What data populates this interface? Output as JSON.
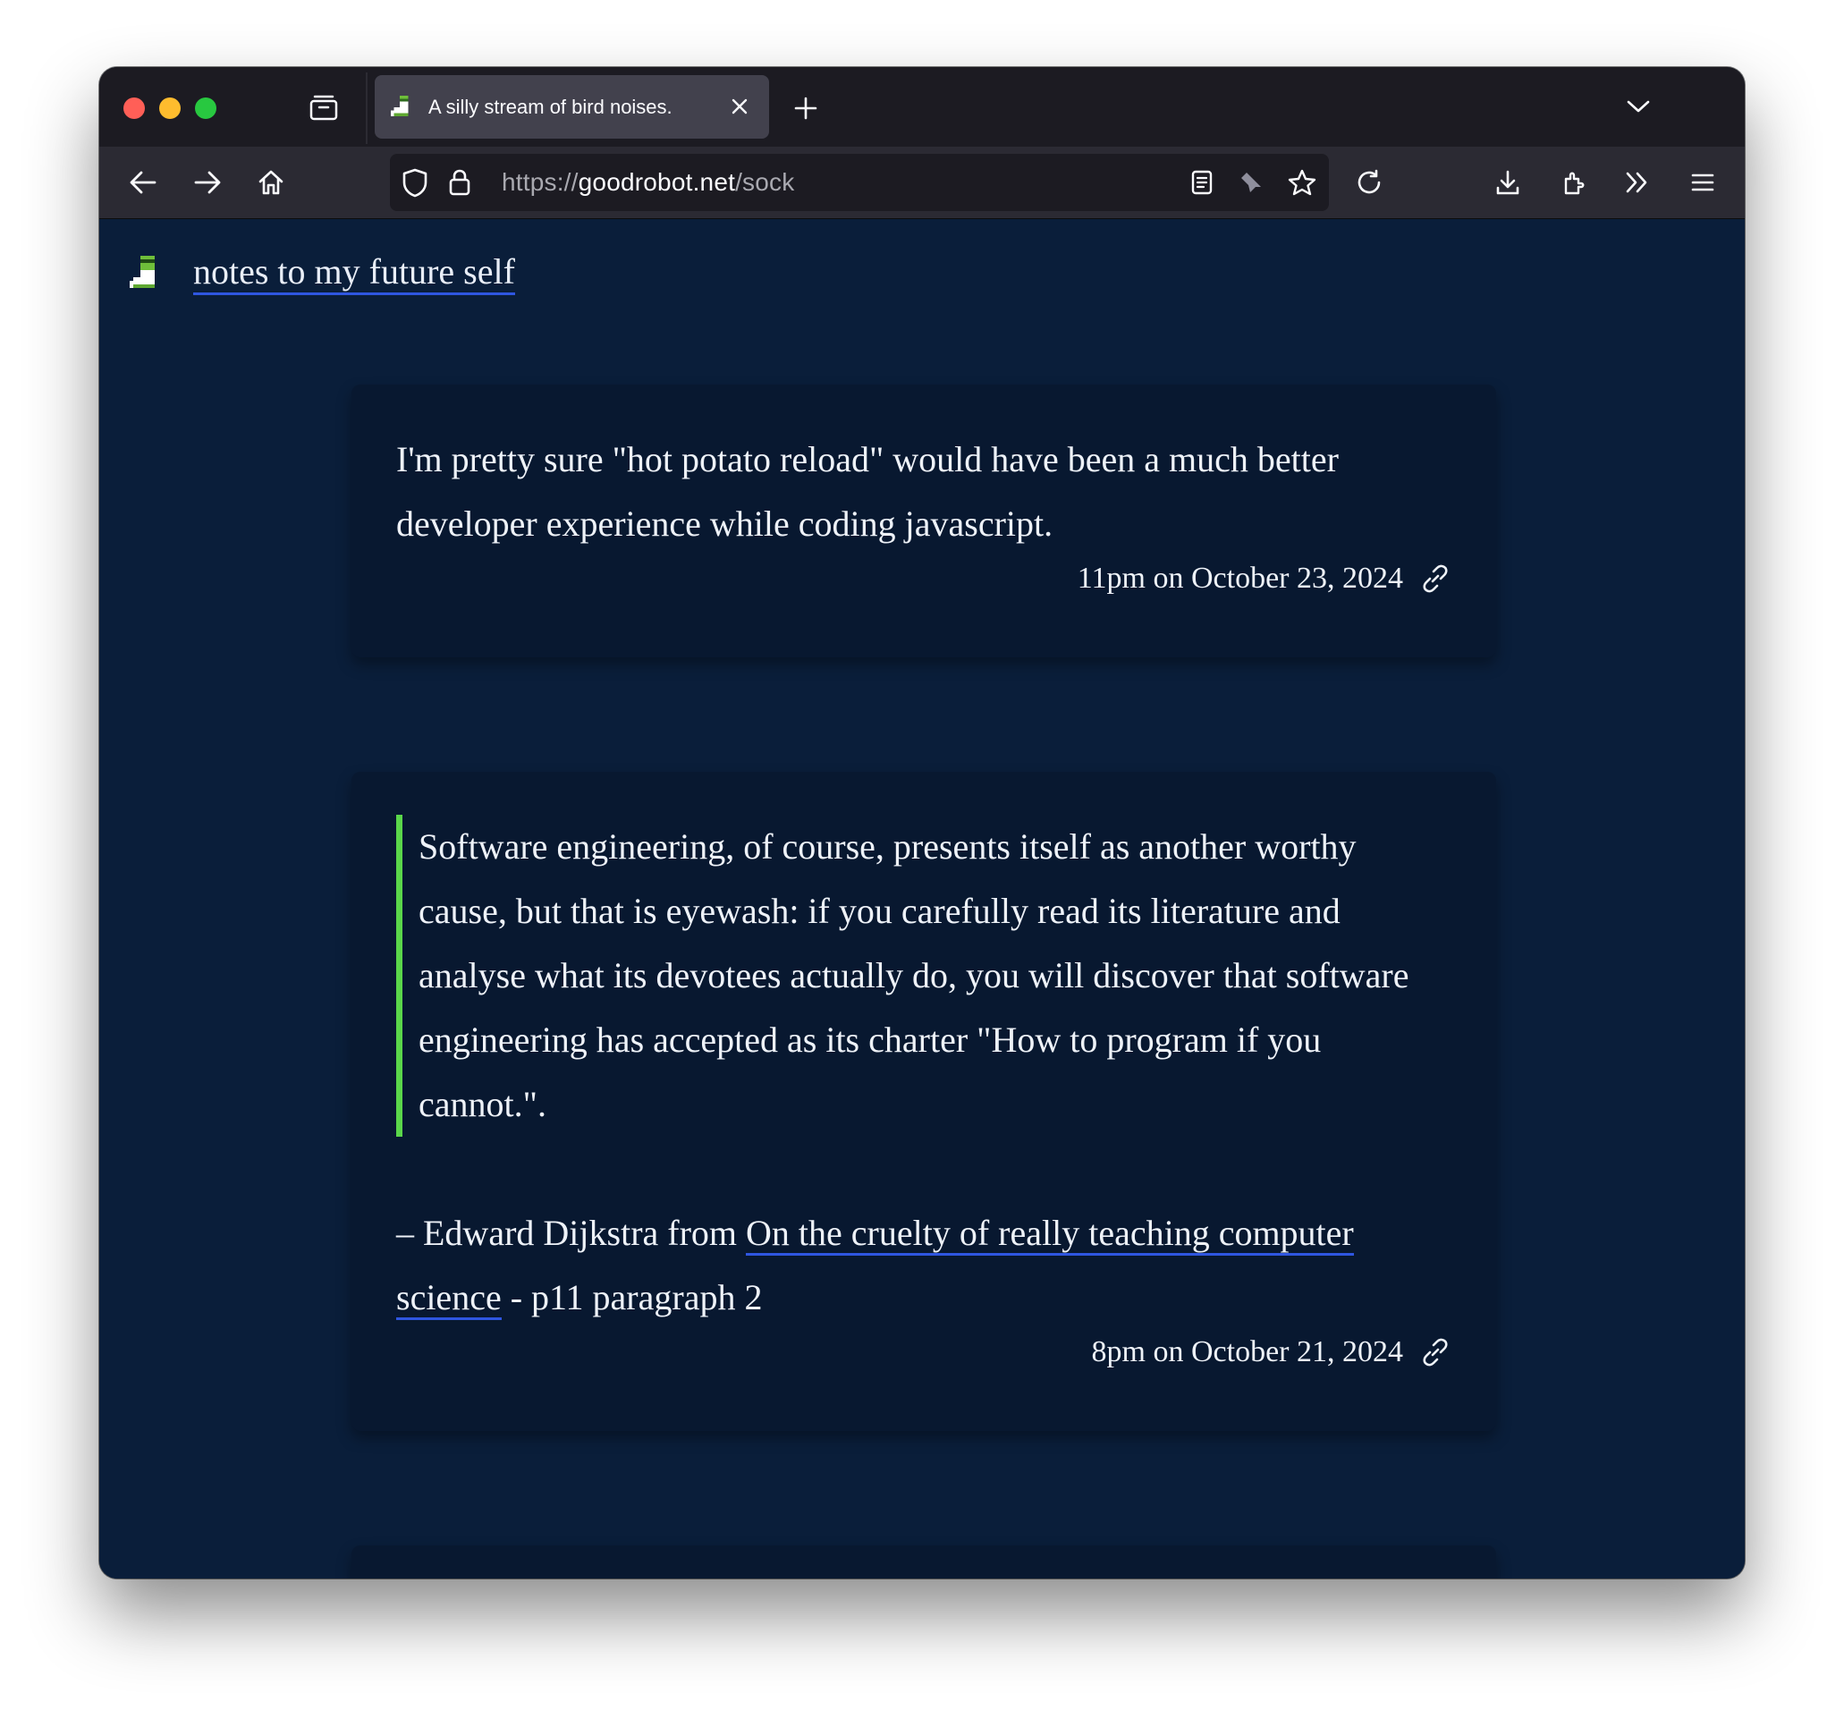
{
  "browser": {
    "tab_title": "A silly stream of bird noises.",
    "url": {
      "scheme": "https://",
      "host": "goodrobot.net",
      "path": "/sock"
    }
  },
  "site": {
    "title": "notes to my future self"
  },
  "posts": [
    {
      "text": "I'm pretty sure \"hot potato reload\" would have been a much better developer experience while coding javascript.",
      "timestamp": "11pm on October 23, 2024"
    },
    {
      "quote": "Software engineering, of course, presents itself as another worthy cause, but that is eyewash: if you carefully read its literature and analyse what its devotees actually do, you will discover that software engineering has accepted as its charter \"How to program if you cannot.\".",
      "attribution_prefix": "– Edward Dijkstra from ",
      "attribution_link": "On the cruelty of really teaching computer science",
      "attribution_suffix": " - p11 paragraph 2",
      "timestamp": "8pm on October 21, 2024"
    }
  ],
  "colors": {
    "page_bg": "#0a1e3a",
    "card_bg": "#081830",
    "quote_bar": "#5ad64a",
    "link_underline": "#2f56e0"
  },
  "icons": {
    "tab_overview": "tab-overview-icon",
    "favicon": "sock-favicon-icon",
    "close": "close-icon",
    "new_tab": "plus-icon",
    "tab_list": "chevron-down-icon",
    "back": "back-arrow-icon",
    "forward": "forward-arrow-icon",
    "home": "home-icon",
    "shield": "shield-icon",
    "lock": "lock-icon",
    "reader": "reader-view-icon",
    "pin": "pin-icon",
    "bookmark": "star-icon",
    "reload": "reload-icon",
    "downloads": "download-icon",
    "extensions": "puzzle-icon",
    "overflow": "double-chevron-icon",
    "menu": "hamburger-icon",
    "permalink": "link-icon"
  }
}
